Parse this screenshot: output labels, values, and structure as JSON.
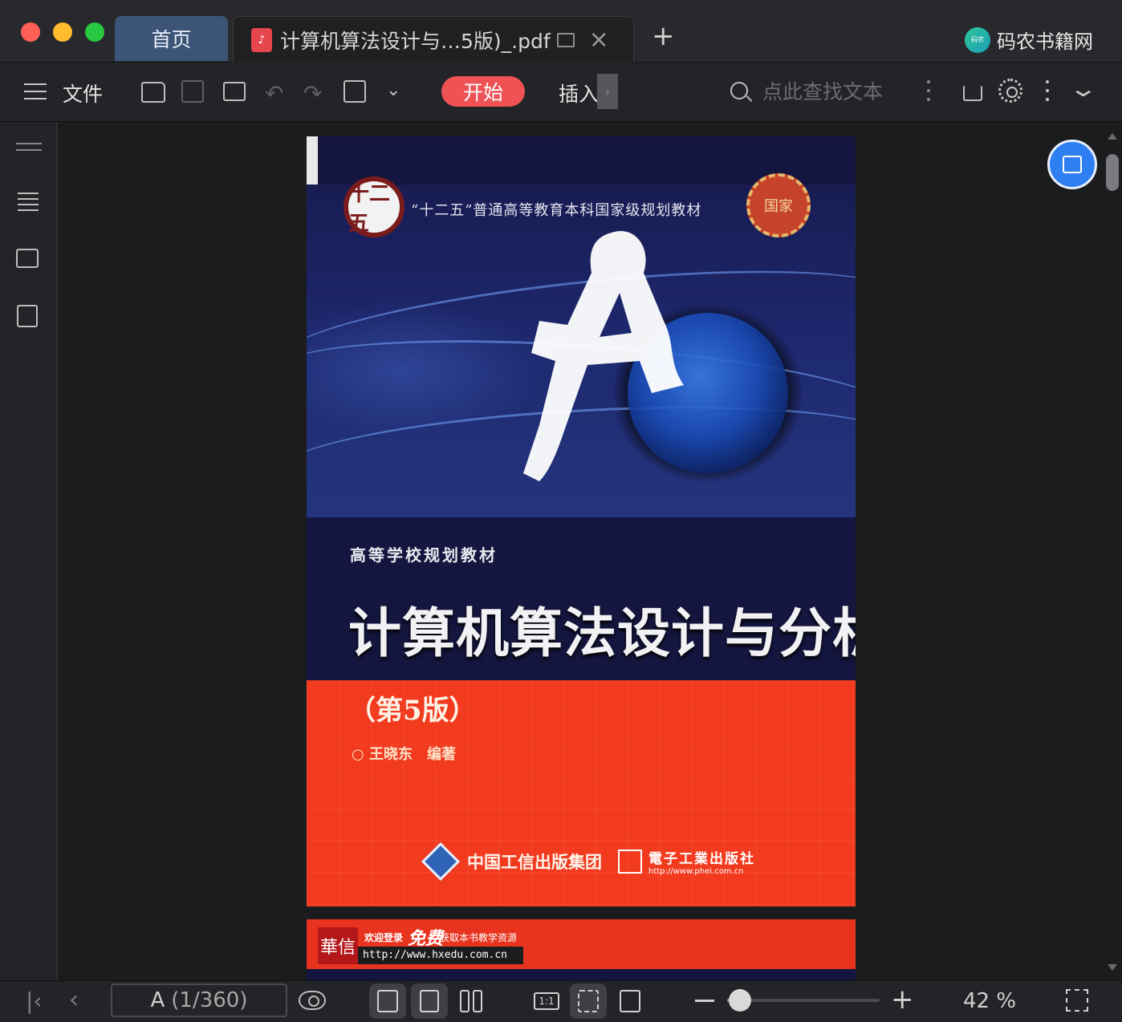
{
  "window": {
    "tabs": [
      {
        "label": "首页",
        "active": false
      },
      {
        "label": "计算机算法设计与…5版)_.pdf",
        "active": true
      }
    ],
    "brand": {
      "name": "码农书籍网",
      "logo_text": "码农"
    }
  },
  "toolbar": {
    "file_label": "文件",
    "start_label": "开始",
    "insert_label": "插入",
    "search_placeholder": "点此查找文本",
    "accent_color": "#ee5254"
  },
  "document": {
    "cover": {
      "series": "“十二五”普通高等教育本科国家级规划教材",
      "emblem_left": "十二五",
      "emblem_right": "国家",
      "subtitle": "高等学校规划教材",
      "title": "计算机算法设计与分析",
      "edition": "（第5版）",
      "author": "○ 王晓东　编著",
      "publisher_group": "中国工信出版集团",
      "publisher": "電子工業出版社",
      "publisher_url": "http://www.phei.com.cn"
    },
    "next_page": {
      "logo": "華信",
      "welcome": "欢迎登录",
      "free": "免费",
      "tail": "获取本书教学资源",
      "url": "http://www.hxedu.com.cn"
    }
  },
  "statusbar": {
    "page_label": "A",
    "page_count": "(1/360)",
    "zoom_percent": 42,
    "zoom_value": "42 %",
    "fit_label": "1:1"
  }
}
